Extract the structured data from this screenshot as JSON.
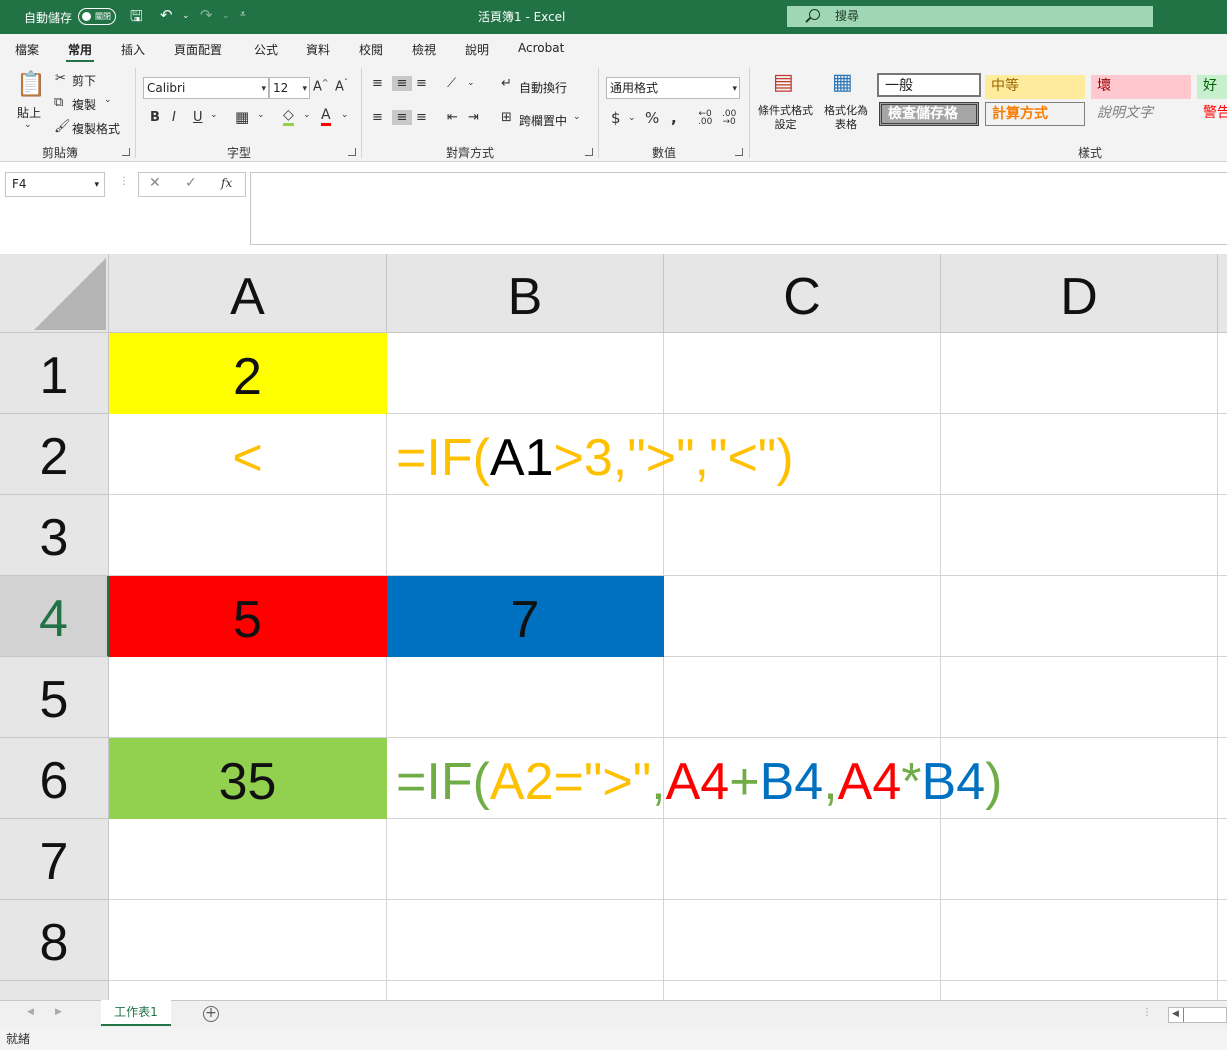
{
  "titlebar": {
    "autosave_label": "自動儲存",
    "autosave_state": "關閉",
    "title": "活頁簿1  -  Excel",
    "search_placeholder": "搜尋"
  },
  "menu": {
    "tabs": [
      "檔案",
      "常用",
      "插入",
      "頁面配置",
      "公式",
      "資料",
      "校閱",
      "檢視",
      "說明",
      "Acrobat"
    ],
    "active": "常用"
  },
  "ribbon": {
    "clipboard": {
      "paste": "貼上",
      "cut": "剪下",
      "copy": "複製",
      "format_painter": "複製格式",
      "label": "剪貼簿"
    },
    "font": {
      "name": "Calibri",
      "size": "12",
      "label": "字型"
    },
    "alignment": {
      "wrap": "自動換行",
      "merge": "跨欄置中",
      "label": "對齊方式"
    },
    "number": {
      "format": "通用格式",
      "label": "數值"
    },
    "styles": {
      "conditional": "條件式格式\n設定",
      "as_table": "格式化為\n表格",
      "label": "樣式",
      "normal": "一般",
      "neutral": "中等",
      "bad": "壞",
      "good": "好",
      "check_cell": "檢查儲存格",
      "calculation": "計算方式",
      "explanatory": "說明文字",
      "warning": "警告"
    }
  },
  "formula_bar": {
    "name_box": "F4",
    "fx": "fx",
    "content": ""
  },
  "grid": {
    "columns": [
      "A",
      "B",
      "C",
      "D"
    ],
    "rows": [
      "1",
      "2",
      "3",
      "4",
      "5",
      "6",
      "7",
      "8"
    ],
    "selected_row": "4",
    "cells": {
      "A1": "2",
      "A2": "<",
      "A4": "5",
      "B4": "7",
      "A6": "35"
    },
    "formula_b2": [
      {
        "t": "=IF(",
        "c": "#FFC000"
      },
      {
        "t": "A1",
        "c": "#000000"
      },
      {
        "t": ">3,\">\",\"<\")",
        "c": "#FFC000"
      }
    ],
    "formula_b6": [
      {
        "t": "=IF(",
        "c": "#70AD47"
      },
      {
        "t": "A2=\">\"",
        "c": "#FFC000"
      },
      {
        "t": ",",
        "c": "#70AD47"
      },
      {
        "t": "A4",
        "c": "#FF0000"
      },
      {
        "t": "+",
        "c": "#70AD47"
      },
      {
        "t": "B4",
        "c": "#0070C0"
      },
      {
        "t": ",",
        "c": "#70AD47"
      },
      {
        "t": "A4",
        "c": "#FF0000"
      },
      {
        "t": "*",
        "c": "#70AD47"
      },
      {
        "t": "B4",
        "c": "#0070C0"
      },
      {
        "t": ")",
        "c": "#70AD47"
      }
    ],
    "colors": {
      "A1": "#FFFF00",
      "A2_text": "#FFC000",
      "A4": "#FF0000",
      "B4": "#0070C0",
      "A6": "#92D050"
    }
  },
  "sheets": {
    "tabs": [
      "工作表1"
    ],
    "add_icon": "plus-circle-icon"
  },
  "status": {
    "text": "就緒"
  }
}
